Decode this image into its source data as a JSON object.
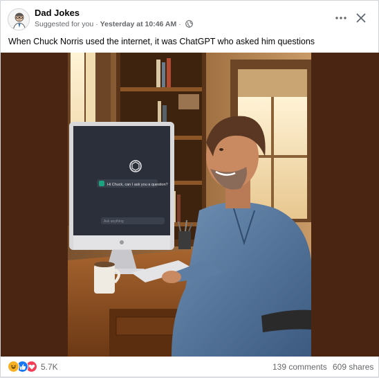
{
  "post": {
    "page_name": "Dad Jokes",
    "suggested": "Suggested for you",
    "separator": "·",
    "timestamp": "Yesterday at 10:46 AM",
    "audience_icon": "globe-icon",
    "caption": "When Chuck Norris used the internet, it was ChatGPT who asked him questions"
  },
  "image": {
    "screen_message": "Hi Chuck, can I ask you a question?",
    "screen_input_placeholder": "Ask anything",
    "side_color": "#4a2511"
  },
  "footer": {
    "reaction_icons": [
      "haha-icon",
      "like-icon",
      "love-icon"
    ],
    "reaction_count": "5.7K",
    "comments": "139 comments",
    "shares": "609 shares"
  },
  "colors": {
    "like": "#1877f2",
    "love": "#f33e58",
    "haha": "#f7b125",
    "muted_text": "#65676b"
  }
}
